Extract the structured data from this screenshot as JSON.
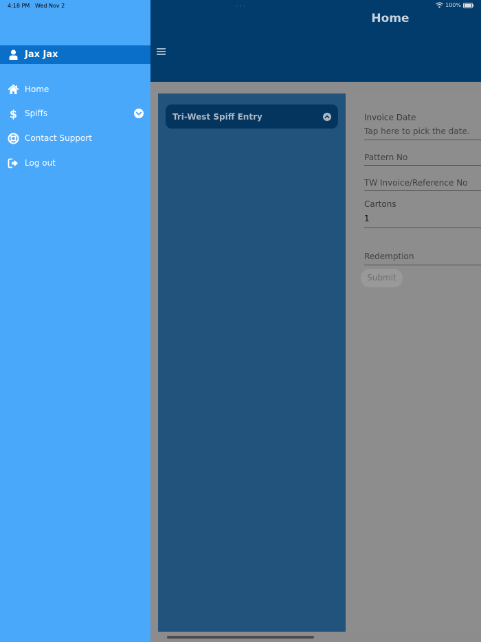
{
  "status_bar": {
    "time": "4:18 PM",
    "date": "Wed Nov 2",
    "battery": "100%"
  },
  "header": {
    "title": "Home"
  },
  "drawer": {
    "user_name": "Jax Jax",
    "items": [
      {
        "label": "Home",
        "icon": "home-icon"
      },
      {
        "label": "Spiffs",
        "icon": "dollar-icon"
      },
      {
        "label": "Contact Support",
        "icon": "lifebuoy-icon"
      },
      {
        "label": "Log out",
        "icon": "logout-icon"
      }
    ]
  },
  "accordion": {
    "title": "Tri-West Spiff Entry"
  },
  "form": {
    "invoice_date_label": "Invoice Date",
    "invoice_date_placeholder": "Tap here to pick the date.",
    "pattern_no_label": "Pattern No",
    "tw_invoice_label": "TW Invoice/Reference No",
    "cartons_label": "Cartons",
    "cartons_value": "1",
    "redemption_label": "Redemption",
    "submit_label": "Submit"
  },
  "colors": {
    "drawer": "#4aa8fb",
    "drawer_user_row": "#0a6fc8",
    "header": "#023c6d",
    "left_panel": "#22537c",
    "accordion": "#04355f"
  }
}
